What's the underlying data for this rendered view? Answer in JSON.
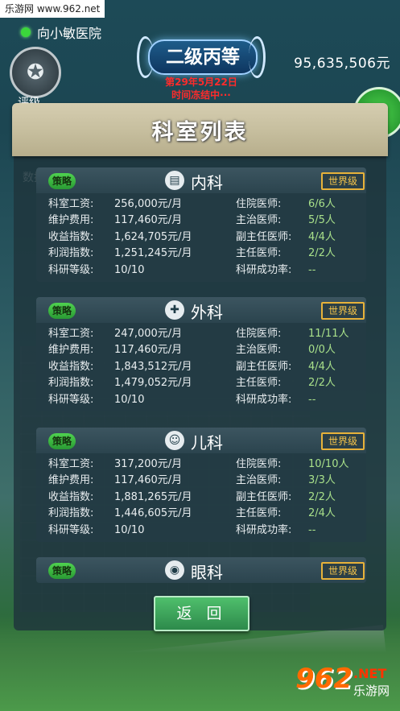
{
  "watermark": "乐游网 www.962.net",
  "hud": {
    "hospital_name": "向小敏医院",
    "rank": "二级丙等",
    "date": "第29年5月22日",
    "freeze": "时间冻结中···",
    "money": "95,635,506元",
    "eval_label": "评级",
    "data_label": "数据"
  },
  "dialog": {
    "title": "科室列表",
    "back_label": "返 回"
  },
  "departments": [
    {
      "name": "内科",
      "icon": "clipboard-icon",
      "strategy": "策略",
      "level": "世界级",
      "rows": [
        {
          "l": "科室工资:",
          "v": "256,000元/月",
          "rl": "住院医师:",
          "rv": "6/6人"
        },
        {
          "l": "维护费用:",
          "v": "117,460元/月",
          "rl": "主治医师:",
          "rv": "5/5人"
        },
        {
          "l": "收益指数:",
          "v": "1,624,705元/月",
          "rl": "副主任医师:",
          "rv": "4/4人"
        },
        {
          "l": "利润指数:",
          "v": "1,251,245元/月",
          "rl": "主任医师:",
          "rv": "2/2人"
        },
        {
          "l": "科研等级:",
          "v": "10/10",
          "rl": "科研成功率:",
          "rv": "--"
        }
      ]
    },
    {
      "name": "外科",
      "icon": "surgery-icon",
      "strategy": "策略",
      "level": "世界级",
      "rows": [
        {
          "l": "科室工资:",
          "v": "247,000元/月",
          "rl": "住院医师:",
          "rv": "11/11人"
        },
        {
          "l": "维护费用:",
          "v": "117,460元/月",
          "rl": "主治医师:",
          "rv": "0/0人"
        },
        {
          "l": "收益指数:",
          "v": "1,843,512元/月",
          "rl": "副主任医师:",
          "rv": "4/4人"
        },
        {
          "l": "利润指数:",
          "v": "1,479,052元/月",
          "rl": "主任医师:",
          "rv": "2/2人"
        },
        {
          "l": "科研等级:",
          "v": "10/10",
          "rl": "科研成功率:",
          "rv": "--"
        }
      ]
    },
    {
      "name": "儿科",
      "icon": "baby-icon",
      "strategy": "策略",
      "level": "世界级",
      "rows": [
        {
          "l": "科室工资:",
          "v": "317,200元/月",
          "rl": "住院医师:",
          "rv": "10/10人"
        },
        {
          "l": "维护费用:",
          "v": "117,460元/月",
          "rl": "主治医师:",
          "rv": "3/3人"
        },
        {
          "l": "收益指数:",
          "v": "1,881,265元/月",
          "rl": "副主任医师:",
          "rv": "2/2人"
        },
        {
          "l": "利润指数:",
          "v": "1,446,605元/月",
          "rl": "主任医师:",
          "rv": "2/4人"
        },
        {
          "l": "科研等级:",
          "v": "10/10",
          "rl": "科研成功率:",
          "rv": "--"
        }
      ]
    },
    {
      "name": "眼科",
      "icon": "eye-icon",
      "strategy": "策略",
      "level": "世界级",
      "rows": []
    }
  ],
  "logo": {
    "num": "962",
    "dotnet": ".NET",
    "sub": "乐游网"
  },
  "colors": {
    "accent_green": "#3bd63b",
    "date_red": "#ff2b2b",
    "level_gold": "#f5c44a",
    "staff_green": "#a8e08a"
  }
}
